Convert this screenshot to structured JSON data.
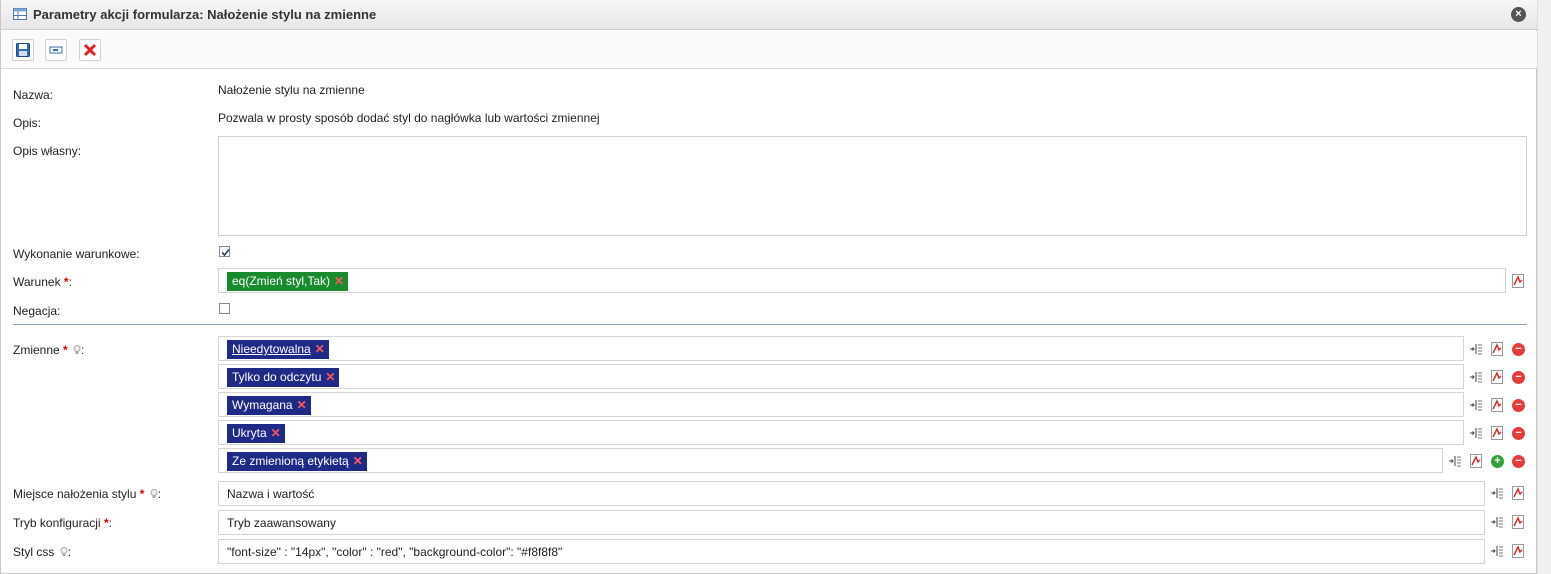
{
  "window": {
    "title": "Parametry akcji formularza: Nałożenie stylu na zmienne",
    "close_icon": "×"
  },
  "toolbar": {
    "buttons": [
      "save-icon",
      "field-icon",
      "delete-icon"
    ]
  },
  "form": {
    "nazwa": {
      "label": "Nazwa:",
      "value": "Nałożenie stylu na zmienne"
    },
    "opis": {
      "label": "Opis:",
      "value": "Pozwala w prosty sposób dodać styl do nagłówka lub wartości zmiennej"
    },
    "opis_wlasny": {
      "label": "Opis własny:",
      "value": ""
    },
    "wykonanie_warunkowe": {
      "label": "Wykonanie warunkowe:",
      "checked": true
    },
    "warunek": {
      "label": "Warunek",
      "required_mark": "*",
      "colon": ":",
      "tag": "eq(Zmień styl,Tak)",
      "remove": "✕"
    },
    "negacja": {
      "label": "Negacja:",
      "checked": false
    },
    "zmienne": {
      "label": "Zmienne",
      "required_mark": "*",
      "colon": ":",
      "items": [
        {
          "label": "Nieedytowalna",
          "remove": "✕"
        },
        {
          "label": "Tylko do odczytu",
          "remove": "✕"
        },
        {
          "label": "Wymagana",
          "remove": "✕"
        },
        {
          "label": "Ukryta",
          "remove": "✕"
        },
        {
          "label": "Ze zmienioną etykietą",
          "remove": "✕"
        }
      ]
    },
    "miejsce": {
      "label": "Miejsce nałożenia stylu",
      "required_mark": "*",
      "colon": ":",
      "value": "Nazwa i wartość"
    },
    "tryb": {
      "label": "Tryb konfiguracji",
      "required_mark": "*",
      "colon": ":",
      "value": "Tryb zaawansowany"
    },
    "styl": {
      "label": "Styl css",
      "colon": ":",
      "value": "\"font-size\" : \"14px\", \"color\" : \"red\", \"background-color\": \"#f8f8f8\""
    }
  },
  "colors": {
    "tag_green": "#1a8a2e",
    "tag_navy": "#1f2a86",
    "required": "#d00000",
    "remove_x": "#ff5a5a"
  }
}
